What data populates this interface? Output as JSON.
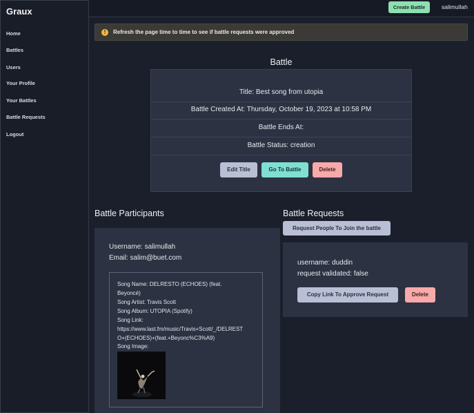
{
  "app": {
    "brand": "Graux"
  },
  "sidebar": {
    "items": [
      {
        "label": "Home"
      },
      {
        "label": "Battles"
      },
      {
        "label": "Users"
      },
      {
        "label": "Your Profile"
      },
      {
        "label": "Your Battles"
      },
      {
        "label": "Battle Requests"
      },
      {
        "label": "Logout"
      }
    ]
  },
  "topbar": {
    "create_label": "Create Battle",
    "username": "salimullah"
  },
  "alert": {
    "icon": "exclamation-icon",
    "text": "Refresh the page time to time to see if battle requests were approved"
  },
  "battle": {
    "heading": "Battle",
    "title_line": "Title: Best song from utopia",
    "created_line": "Battle Created At: Thursday, October 19, 2023 at 10:58 PM",
    "ends_line": "Battle Ends At:",
    "status_line": "Battle Status: creation",
    "edit_label": "Edit Title",
    "goto_label": "Go To Battle",
    "delete_label": "Delete"
  },
  "participants": {
    "heading": "Battle Participants",
    "username_line": "Username: salimullah",
    "email_line": "Email: salim@buet.com",
    "song": {
      "name_line1": "Song Name: DELRESTO (ECHOES) (feat.",
      "name_line2": "Beyoncé)",
      "artist_line": "Song Artist: Travis Scott",
      "album_line": "Song Album: UTOPIA (Spotify)",
      "link_label": "Song Link:",
      "link_line1": "https://www.last.fm/music/Travis+Scott/_/DELREST",
      "link_line2": "O+(ECHOES)+(feat.+Beyonc%C3%A9)",
      "image_label": "Song Image:"
    }
  },
  "requests": {
    "heading": "Battle Requests",
    "request_btn_label": "Request People To Join the battle",
    "username_line": "username: duddin",
    "validated_line": "request validated: false",
    "copy_label": "Copy Link To Approve Request",
    "delete_label": "Delete"
  },
  "colors": {
    "background": "#1b1f2b",
    "card": "#2c3242",
    "accent_green": "#8ee0b2",
    "accent_teal": "#7fdfd3",
    "accent_pink": "#f8a9a9",
    "button_gray": "#b9bfd4",
    "warning": "#f4b740"
  }
}
